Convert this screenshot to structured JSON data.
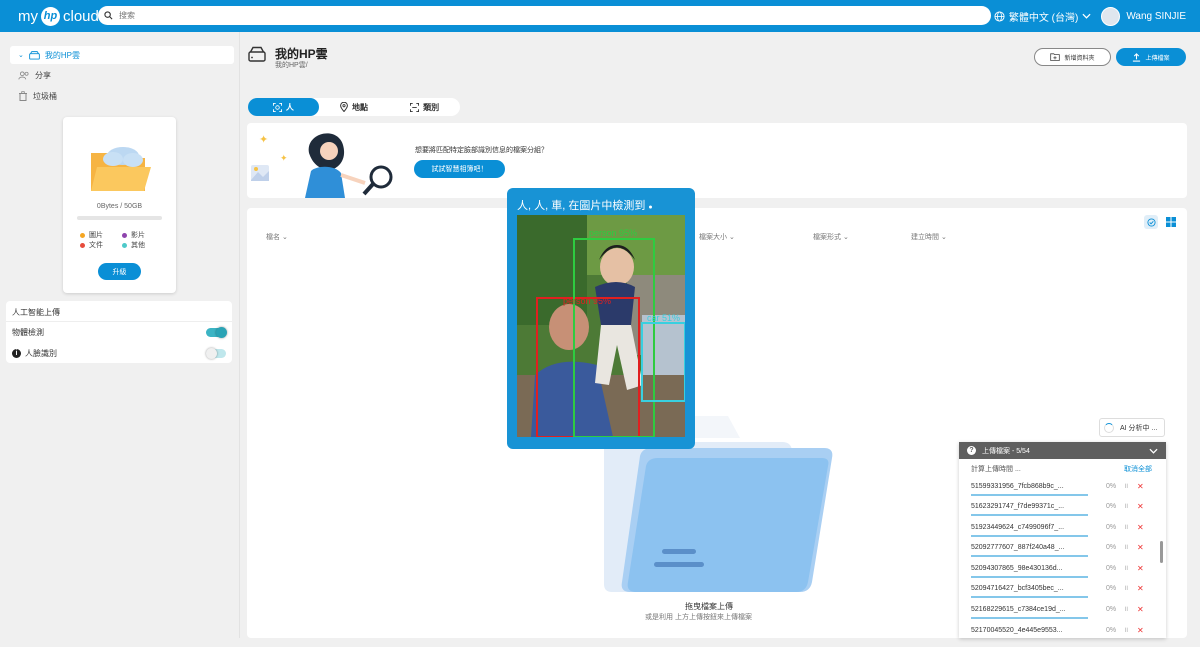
{
  "header": {
    "logo_text": "my",
    "logo_hp": "hp",
    "logo_cloud": "cloud",
    "search_placeholder": "搜索",
    "help_icon": "question-circle-icon",
    "language": "繁體中文 (台灣)",
    "user_name": "Wang SINJIE"
  },
  "sidebar": {
    "items": [
      {
        "label": "我的HP雲",
        "icon": "drive-icon",
        "active": true
      },
      {
        "label": "分享",
        "icon": "users-icon",
        "active": false
      },
      {
        "label": "垃圾桶",
        "icon": "trash-icon",
        "active": false
      }
    ],
    "storage": {
      "usage_text": "0Bytes / 50GB",
      "usage_fraction": 0,
      "legend": [
        {
          "label": "圖片",
          "color": "#f5a623"
        },
        {
          "label": "影片",
          "color": "#8e44ad"
        },
        {
          "label": "文件",
          "color": "#e74c3c"
        },
        {
          "label": "其他",
          "color": "#4ec9c9"
        }
      ],
      "upgrade_label": "升級"
    },
    "ai_upload": {
      "title": "人工智能上傳",
      "object_detection_label": "物體檢測",
      "object_detection_on": true,
      "face_recognition_label": "人臉識別",
      "face_recognition_on": false
    }
  },
  "main": {
    "title": "我的HP雲",
    "breadcrumb": "我的HP雲/",
    "new_folder_label": "新增資料夾",
    "upload_label": "上傳檔案",
    "tabs": [
      {
        "label": "人",
        "icon": "face-scan-icon",
        "active": true
      },
      {
        "label": "地點",
        "icon": "location-pin-icon",
        "active": false
      },
      {
        "label": "類別",
        "icon": "category-scan-icon",
        "active": false
      }
    ],
    "banner": {
      "question": "想要將匹配特定臉部識別信息的檔案分組？",
      "button_label": "試試智慧相簿吧！"
    },
    "columns": [
      "檔名",
      "檔案大小",
      "檔案形式",
      "建立時間"
    ],
    "drop_title": "拖曳檔案上傳",
    "drop_subtitle": "或是利用 上方上傳按鈕來上傳檔案"
  },
  "detection_popup": {
    "title": "人, 人, 車, 在圖片中檢測到",
    "detections": [
      {
        "label": "person 95%",
        "color": "#e02020"
      },
      {
        "label": "person 95%",
        "color": "#2ecc40"
      },
      {
        "label": "car 51%",
        "color": "#38d0e0"
      }
    ]
  },
  "ai_status": "AI 分析中 ...",
  "upload_panel": {
    "title": "上傳檔案 - 5/54",
    "subtitle": "計算上傳時間 ...",
    "cancel_all": "取消全部",
    "files": [
      {
        "name": "51599331956_7fcb868b9c_...",
        "progress": "0%"
      },
      {
        "name": "51623291747_f7de99371c_...",
        "progress": "0%"
      },
      {
        "name": "51923449624_c7499096f7_...",
        "progress": "0%"
      },
      {
        "name": "52092777607_887f240a48_...",
        "progress": "0%"
      },
      {
        "name": "52094307865_98e430136d...",
        "progress": "0%"
      },
      {
        "name": "52094716427_bcf3405bec_...",
        "progress": "0%"
      },
      {
        "name": "52168229615_c7384ce19d_...",
        "progress": "0%"
      },
      {
        "name": "52170045520_4e445e9553...",
        "progress": "0%"
      }
    ],
    "pause_glyph": "॥",
    "cancel_glyph": "✕"
  }
}
